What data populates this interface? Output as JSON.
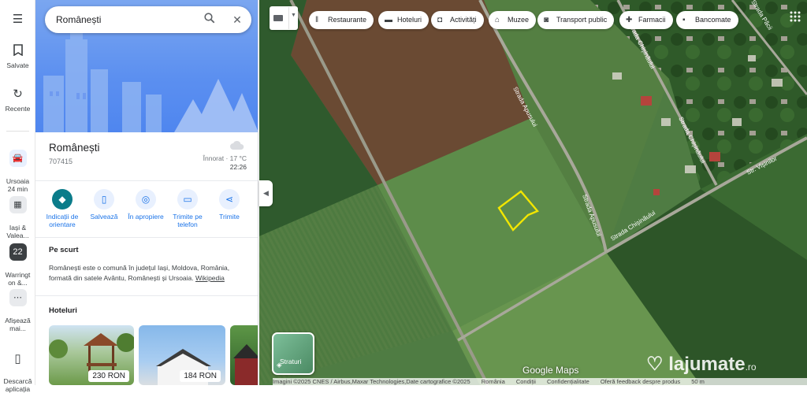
{
  "rail": {
    "saved": "Salvate",
    "recent": "Recente",
    "trip": "Ursoaia\n24 min",
    "recent_place_1": "Iași &\nValea...",
    "recent_place_2": "Warringt\non &...",
    "recent_place_2_badge": "22",
    "more": "Afișează\nmai...",
    "download": "Descarcă\naplicația"
  },
  "search": {
    "value": "Românești"
  },
  "place": {
    "title": "Românești",
    "postal_code": "707415",
    "weather_text": "Înnorat · 17 °C",
    "weather_time": "22:26"
  },
  "actions": [
    {
      "label": "Indicații de orientare",
      "icon": "directions-icon"
    },
    {
      "label": "Salvează",
      "icon": "bookmark-icon"
    },
    {
      "label": "În apropiere",
      "icon": "nearby-icon"
    },
    {
      "label": "Trimite pe telefon",
      "icon": "phone-icon"
    },
    {
      "label": "Trimite",
      "icon": "share-icon"
    }
  ],
  "summary": {
    "heading": "Pe scurt",
    "text": "Românești este o comună în județul Iași, Moldova, România, formată din satele Avântu, Românești și Ursoaia.",
    "link": "Wikipedia"
  },
  "hotels": {
    "heading": "Hoteluri",
    "items": [
      {
        "price": "230 RON"
      },
      {
        "price": "184 RON"
      }
    ]
  },
  "chips": [
    {
      "label": "Restaurante",
      "icon": "restaurant-icon"
    },
    {
      "label": "Hoteluri",
      "icon": "hotel-icon"
    },
    {
      "label": "Activități",
      "icon": "camera-icon"
    },
    {
      "label": "Muzee",
      "icon": "museum-icon"
    },
    {
      "label": "Transport public",
      "icon": "transit-icon"
    },
    {
      "label": "Farmacii",
      "icon": "pharmacy-icon"
    },
    {
      "label": "Bancomate",
      "icon": "atm-icon"
    }
  ],
  "map": {
    "streets": [
      "Strada Apusului",
      "Strada Apusului",
      "Strada Chișinăului",
      "Strada Chișinăului",
      "Strada Chișinăului",
      "Str. Vișinilor",
      "Strada Păcii"
    ],
    "layers_label": "Straturi",
    "logo": "Google Maps",
    "attribution": [
      "Imagini ©2025 CNES / Airbus,Maxar Technologies,Date cartografice ©2025",
      "România",
      "Condiții",
      "Confidențialitate",
      "Oferă feedback despre produs",
      "50 m"
    ],
    "watermark": "lajumate",
    "watermark_suffix": ".ro",
    "colors": {
      "boundary": "#f2e600",
      "accent": "#1a73e8"
    }
  }
}
